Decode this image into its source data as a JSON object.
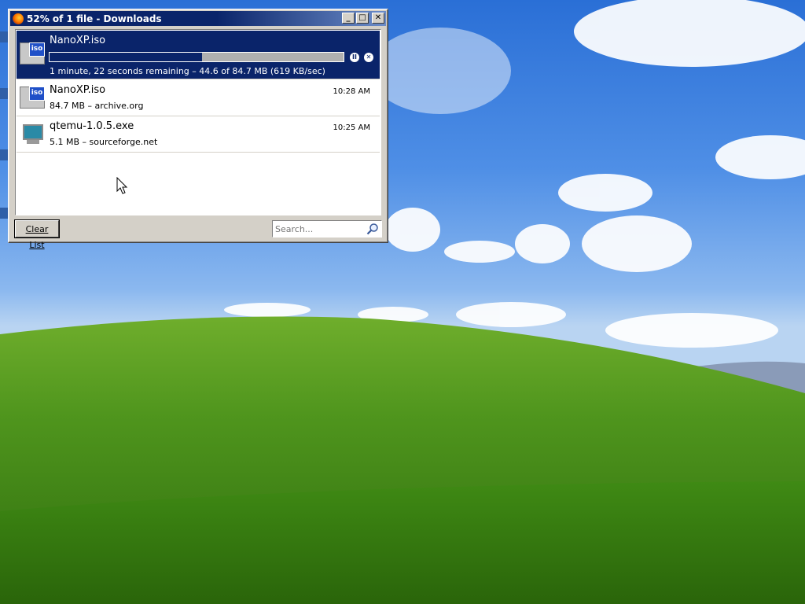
{
  "window": {
    "title": "52% of 1 file - Downloads",
    "minimize_glyph": "_",
    "maximize_glyph": "□",
    "close_glyph": "✕"
  },
  "downloads": [
    {
      "name": "NanoXP.iso",
      "status": "1 minute, 22 seconds remaining – 44.6 of 84.7 MB (619 KB/sec)",
      "progress_percent": 52,
      "active": true,
      "icon": "iso-file-icon",
      "icon_badge": "iso"
    },
    {
      "name": "NanoXP.iso",
      "info": "84.7 MB – archive.org",
      "time": "10:28 AM",
      "icon": "iso-file-icon",
      "icon_badge": "iso"
    },
    {
      "name": "qtemu-1.0.5.exe",
      "info": "5.1 MB – sourceforge.net",
      "time": "10:25 AM",
      "icon": "exe-file-icon"
    }
  ],
  "controls": {
    "pause_glyph": "II",
    "cancel_glyph": "✕"
  },
  "footer": {
    "clear_label": "Clear List",
    "search_placeholder": "Search..."
  },
  "colors": {
    "selection": "#0a246a",
    "titlebar_end": "#6b8cc8",
    "window_face": "#d4d0c8"
  }
}
